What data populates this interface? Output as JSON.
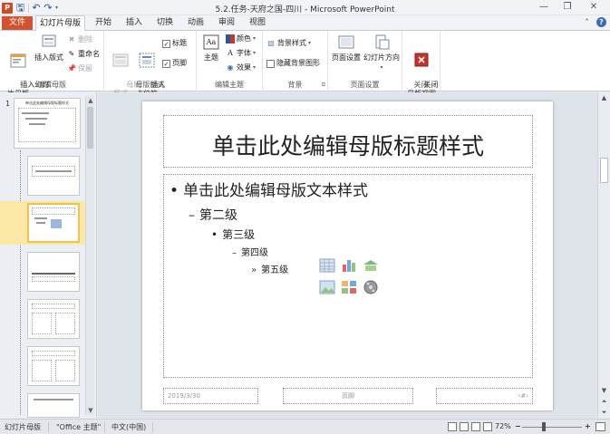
{
  "window": {
    "title": "5.2.任务-天府之国-四川 - Microsoft PowerPoint"
  },
  "qat": {
    "logo": "P",
    "save": "🖫",
    "undo": "↶",
    "redo": "↷"
  },
  "wctl": {
    "minimize": "—",
    "restore": "❐",
    "close": "✕"
  },
  "tabs": {
    "file": "文件",
    "items": [
      "幻灯片母版",
      "开始",
      "插入",
      "切换",
      "动画",
      "审阅",
      "视图"
    ]
  },
  "ribbon": {
    "edit_master": {
      "label": "编辑母版",
      "insert_master": "插入幻灯\n片母版",
      "insert_layout": "插入版式",
      "delete": "删除",
      "rename": "重命名",
      "preserve": "保留"
    },
    "master_layout": {
      "label": "母版版式",
      "master_layout": "母版\n版式",
      "insert_placeholder": "插入\n占位符",
      "title": "标题",
      "footer": "页脚"
    },
    "edit_theme": {
      "label": "编辑主题",
      "theme": "主题",
      "colors": "颜色",
      "fonts": "字体",
      "effects": "效果"
    },
    "background": {
      "label": "背景",
      "bg_styles": "背景样式",
      "hide_bg": "隐藏背景图形"
    },
    "page_setup": {
      "label": "页面设置",
      "page_setup": "页面设置",
      "orientation": "幻灯片方向"
    },
    "close": {
      "label": "关闭",
      "close_view": "关闭\n母版视图"
    }
  },
  "panel": {
    "first_number": "1"
  },
  "slide": {
    "title": "单击此处编辑母版标题样式",
    "levels": [
      "单击此处编辑母版文本样式",
      "第二级",
      "第三级",
      "第四级",
      "第五级"
    ],
    "bullets": [
      "•",
      "–",
      "•",
      "–",
      "»"
    ],
    "footer_date": "2019/3/30",
    "footer_text": "页脚",
    "footer_num": "‹#›"
  },
  "status": {
    "view": "幻灯片母版",
    "theme": "\"Office 主题\"",
    "language": "中文(中国)",
    "zoom": "72%",
    "zoom_out": "−",
    "zoom_in": "+"
  },
  "colors": {
    "file_tab": "#d35230",
    "selected_thumb": "#f1c24f",
    "close_master": "#c8312a"
  }
}
